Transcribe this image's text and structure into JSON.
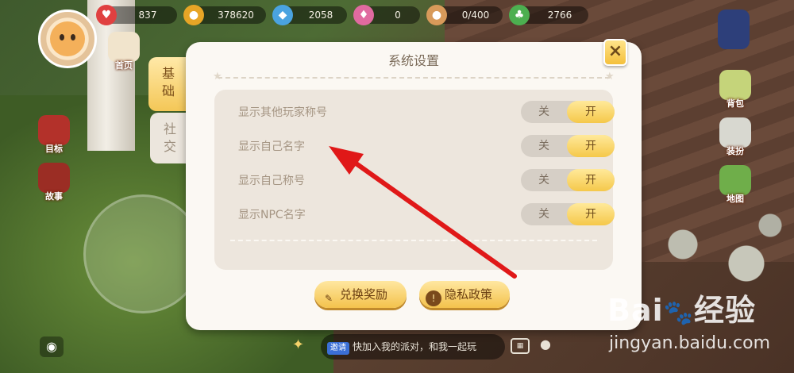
{
  "resources": [
    {
      "icon": "heart-icon",
      "value": "837",
      "color": "#e04040"
    },
    {
      "icon": "coin-icon",
      "value": "378620",
      "color": "#e7a526"
    },
    {
      "icon": "gem-icon",
      "value": "2058",
      "color": "#4aa3e0"
    },
    {
      "icon": "diamond-icon",
      "value": "0",
      "color": "#e06aa0"
    },
    {
      "icon": "hamster-icon",
      "value": "0/400",
      "color": "#d89a5a"
    },
    {
      "icon": "clover-icon",
      "value": "2766",
      "color": "#4caf50"
    }
  ],
  "left_menu": {
    "item1": "目标",
    "item2": "故事"
  },
  "right_menu": {
    "item1": "背包",
    "item2": "装扮",
    "item3": "地图"
  },
  "top_menu": {
    "item1": "首页"
  },
  "dialog": {
    "title": "系统设置",
    "close_label": "×",
    "tabs": [
      {
        "label": "基\n础",
        "active": true
      },
      {
        "label": "社\n交",
        "active": false
      }
    ],
    "settings": [
      {
        "label": "显示其他玩家称号",
        "off_label": "关",
        "on_label": "开",
        "value": "开"
      },
      {
        "label": "显示自己名字",
        "off_label": "关",
        "on_label": "开",
        "value": "开"
      },
      {
        "label": "显示自己称号",
        "off_label": "关",
        "on_label": "开",
        "value": "开"
      },
      {
        "label": "显示NPC名字",
        "off_label": "关",
        "on_label": "开",
        "value": "开"
      }
    ],
    "buttons": {
      "redeem": "兑换奖励",
      "privacy": "隐私政策"
    }
  },
  "chat": {
    "tag": "邀请",
    "text": "快加入我的派对，和我一起玩"
  },
  "watermark": {
    "brand_left": "Bai",
    "brand_right": "经验",
    "site": "jingyan.baidu.com"
  },
  "annotation_color": "#e01818"
}
